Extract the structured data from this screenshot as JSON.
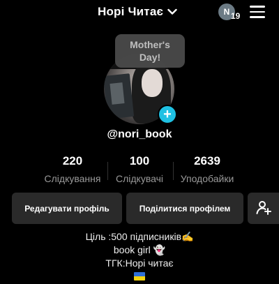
{
  "header": {
    "title": "Норі Читає",
    "notification_avatar_letter": "N",
    "notification_count": "19"
  },
  "tooltip": {
    "text": "Mother's Day!"
  },
  "profile": {
    "username": "@nori_book"
  },
  "stats": [
    {
      "value": "220",
      "label": "Слідкування"
    },
    {
      "value": "100",
      "label": "Слідкувачі"
    },
    {
      "value": "2639",
      "label": "Уподобайки"
    }
  ],
  "actions": {
    "edit_profile": "Редагувати профіль",
    "share_profile": "Поділитися профілем"
  },
  "bio": {
    "line1": "Ціль :500 підписників✍️",
    "line2": "book girl 👻",
    "line3": "ТГК:Норі читає"
  },
  "colors": {
    "background": "#000000",
    "accent_add": "#1fc1e3",
    "button_bg": "#2a2a2a",
    "muted_text": "#9a9a9a"
  }
}
